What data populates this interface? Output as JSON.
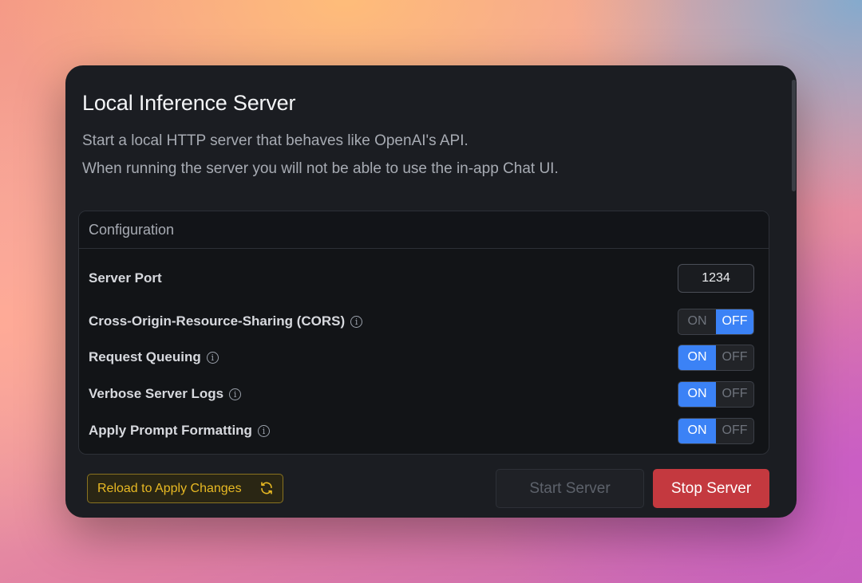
{
  "panel": {
    "title": "Local Inference Server",
    "description_line1": "Start a local HTTP server that behaves like OpenAI's API.",
    "description_line2": "When running the server you will not be able to use the in-app Chat UI."
  },
  "config": {
    "header": "Configuration",
    "server_port": {
      "label": "Server Port",
      "value": "1234"
    },
    "cors": {
      "label": "Cross-Origin-Resource-Sharing (CORS)",
      "on_label": "ON",
      "off_label": "OFF",
      "state": "off",
      "info_icon": "info-icon"
    },
    "request_queuing": {
      "label": "Request Queuing",
      "on_label": "ON",
      "off_label": "OFF",
      "state": "on",
      "info_icon": "info-icon"
    },
    "verbose_logs": {
      "label": "Verbose Server Logs",
      "on_label": "ON",
      "off_label": "OFF",
      "state": "on",
      "info_icon": "info-icon"
    },
    "prompt_formatting": {
      "label": "Apply Prompt Formatting",
      "on_label": "ON",
      "off_label": "OFF",
      "state": "on",
      "info_icon": "info-icon"
    }
  },
  "footer": {
    "reload_label": "Reload to Apply Changes",
    "reload_icon": "refresh-icon",
    "start_label": "Start Server",
    "stop_label": "Stop Server"
  },
  "colors": {
    "accent_blue": "#3b82f6",
    "stop_red": "#c4393f",
    "warning_yellow": "#e8b923"
  }
}
